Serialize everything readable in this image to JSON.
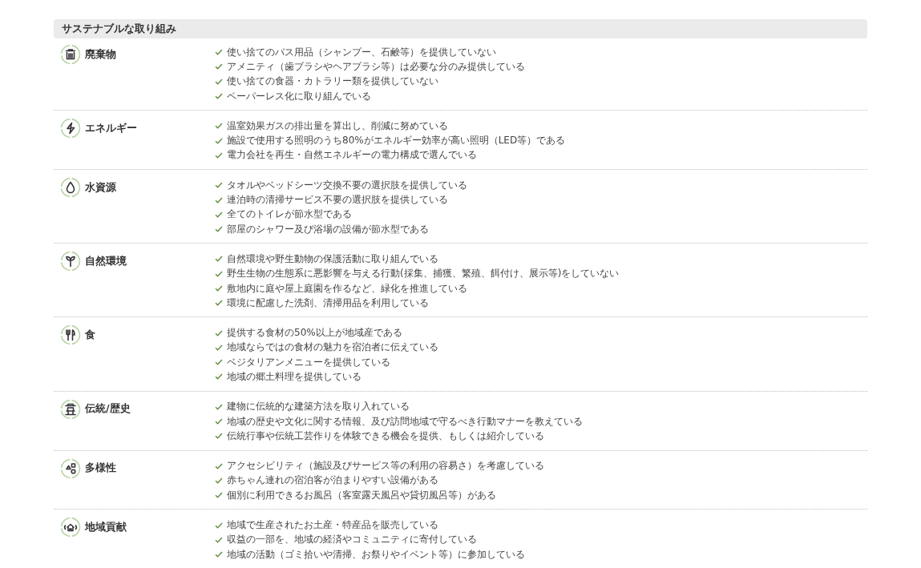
{
  "section": {
    "title": "サステナブルな取り組み"
  },
  "categories": [
    {
      "kind": "waste",
      "label": "廃棄物",
      "items": [
        "使い捨てのバス用品（シャンプー、石鹸等）を提供していない",
        "アメニティ（歯ブラシやヘアブラシ等）は必要な分のみ提供している",
        "使い捨ての食器・カトラリー類を提供していない",
        "ペーパーレス化に取り組んでいる"
      ]
    },
    {
      "kind": "energy",
      "label": "エネルギー",
      "items": [
        "温室効果ガスの排出量を算出し、削減に努めている",
        "施設で使用する照明のうち80%がエネルギー効率が高い照明（LED等）である",
        "電力会社を再生・自然エネルギーの電力構成で選んでいる"
      ]
    },
    {
      "kind": "water",
      "label": "水資源",
      "items": [
        "タオルやベッドシーツ交換不要の選択肢を提供している",
        "連泊時の清掃サービス不要の選択肢を提供している",
        "全てのトイレが節水型である",
        "部屋のシャワー及び浴場の設備が節水型である"
      ]
    },
    {
      "kind": "nature",
      "label": "自然環境",
      "items": [
        "自然環境や野生動物の保護活動に取り組んでいる",
        "野生生物の生態系に悪影響を与える行動(採集、捕獲、繁殖、餌付け、展示等)をしていない",
        "敷地内に庭や屋上庭園を作るなど、緑化を推進している",
        "環境に配慮した洗剤、清掃用品を利用している"
      ]
    },
    {
      "kind": "food",
      "label": "食",
      "items": [
        "提供する食材の50%以上が地域産である",
        "地域ならではの食材の魅力を宿泊者に伝えている",
        "ベジタリアンメニューを提供している",
        "地域の郷土料理を提供している"
      ]
    },
    {
      "kind": "tradition",
      "label": "伝統/歴史",
      "items": [
        "建物に伝統的な建築方法を取り入れている",
        "地域の歴史や文化に関する情報、及び訪問地域で守るべき行動マナーを教えている",
        "伝統行事や伝統工芸作りを体験できる機会を提供、もしくは紹介している"
      ]
    },
    {
      "kind": "diversity",
      "label": "多様性",
      "items": [
        "アクセシビリティ（施設及びサービス等の利用の容易さ）を考慮している",
        "赤ちゃん連れの宿泊客が泊まりやすい設備がある",
        "個別に利用できるお風呂（客室露天風呂や貸切風呂等）がある"
      ]
    },
    {
      "kind": "community",
      "label": "地域貢献",
      "items": [
        "地域で生産されたお土産・特産品を販売している",
        "収益の一部を、地域の経済やコミュニティに寄付している",
        "地域の活動（ゴミ拾いや清掃、お祭りやイベント等）に参加している"
      ]
    }
  ]
}
